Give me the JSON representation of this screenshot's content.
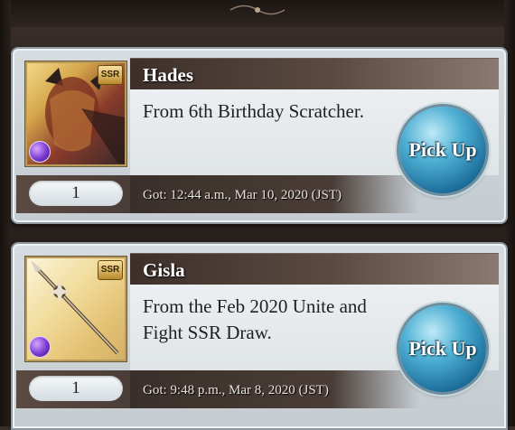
{
  "items": [
    {
      "name": "Hades",
      "rarity": "SSR",
      "element": "dark-element-icon",
      "description": "From 6th Birthday Scratcher.",
      "count": "1",
      "got": "Got: 12:44 a.m., Mar 10, 2020 (JST)",
      "pickup_label": "Pick Up"
    },
    {
      "name": "Gisla",
      "rarity": "SSR",
      "element": "dark-element-icon",
      "description": "From the Feb 2020 Unite and Fight SSR Draw.",
      "count": "1",
      "got": "Got: 9:48 p.m., Mar 8, 2020 (JST)",
      "pickup_label": "Pick Up"
    }
  ],
  "colors": {
    "pickup_button": "#2a8ab8",
    "name_bar": "#3d302a",
    "background": "#2a221e"
  }
}
